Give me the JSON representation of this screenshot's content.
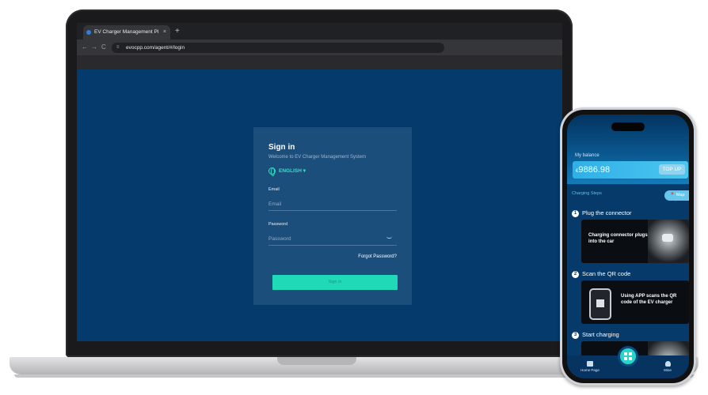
{
  "browser": {
    "tab_title": "EV Charger Management Pl",
    "tab_close": "×",
    "new_tab": "+",
    "nav_back": "←",
    "nav_forward": "→",
    "nav_reload": "C",
    "url": "evocpp.com/agent/#/login",
    "url_icon": "≡"
  },
  "login": {
    "title": "Sign in",
    "subtitle": "Welcome to EV Charger Management System",
    "language": "ENGLISH ▾",
    "email_label": "Email",
    "email_placeholder": "Email",
    "password_label": "Password",
    "password_placeholder": "Password",
    "forgot": "Forgot Password?",
    "signin_button": "Sign in"
  },
  "phone": {
    "balance_label": "My balance",
    "currency": "€",
    "balance_value": "9886.98",
    "topup": "TOP UP",
    "steps_label": "Charging Steps",
    "map_button": "📍 Map",
    "steps": [
      {
        "num": "1",
        "title": "Plug the connector",
        "card_text": "Charging connector plugs into the car"
      },
      {
        "num": "2",
        "title": "Scan the QR code",
        "card_text": "Using APP scans the QR code of the EV charger"
      },
      {
        "num": "3",
        "title": "Start charging",
        "card_text": ""
      }
    ],
    "tabbar": {
      "home": "Home Page",
      "mine": "Mine"
    }
  },
  "colors": {
    "page_bg": "#043a6c",
    "login_panel": "#1c4e7c",
    "accent": "#1fd9b7",
    "phone_bg": "#053a6b"
  }
}
